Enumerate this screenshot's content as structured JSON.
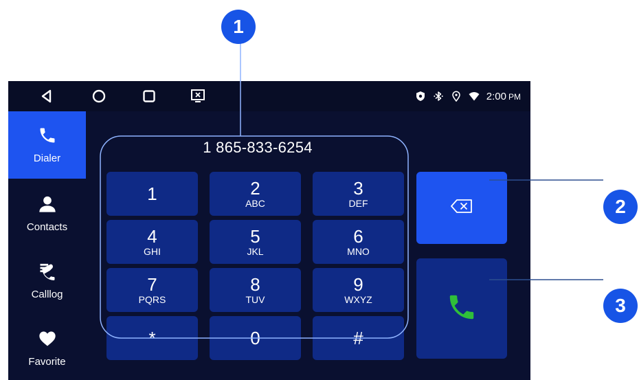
{
  "status_bar": {
    "nav_back_icon": "back-triangle-icon",
    "nav_home_icon": "home-circle-icon",
    "nav_recents_icon": "recents-square-icon",
    "nav_screen_icon": "screen-close-icon",
    "time": "2:00",
    "ampm": "PM"
  },
  "sidebar": {
    "items": [
      {
        "label": "Dialer",
        "icon": "phone-icon",
        "active": true
      },
      {
        "label": "Contacts",
        "icon": "person-icon",
        "active": false
      },
      {
        "label": "Calllog",
        "icon": "call-log-icon",
        "active": false
      },
      {
        "label": "Favorite",
        "icon": "heart-icon",
        "active": false
      }
    ]
  },
  "dialer": {
    "number": "1 865-833-6254",
    "keys": [
      {
        "digit": "1",
        "letters": ""
      },
      {
        "digit": "2",
        "letters": "ABC"
      },
      {
        "digit": "3",
        "letters": "DEF"
      },
      {
        "digit": "4",
        "letters": "GHI"
      },
      {
        "digit": "5",
        "letters": "JKL"
      },
      {
        "digit": "6",
        "letters": "MNO"
      },
      {
        "digit": "7",
        "letters": "PQRS"
      },
      {
        "digit": "8",
        "letters": "TUV"
      },
      {
        "digit": "9",
        "letters": "WXYZ"
      },
      {
        "digit": "*",
        "letters": ""
      },
      {
        "digit": "0",
        "letters": ""
      },
      {
        "digit": "#",
        "letters": ""
      }
    ],
    "backspace_icon": "backspace-icon",
    "call_icon": "call-phone-icon"
  },
  "callouts": [
    "1",
    "2",
    "3"
  ],
  "colors": {
    "screen_bg": "#0a1030",
    "key_bg": "#0f2a86",
    "active_blue": "#1e54f0",
    "call_green": "#2fbf3a",
    "badge_blue": "#1754e6"
  }
}
